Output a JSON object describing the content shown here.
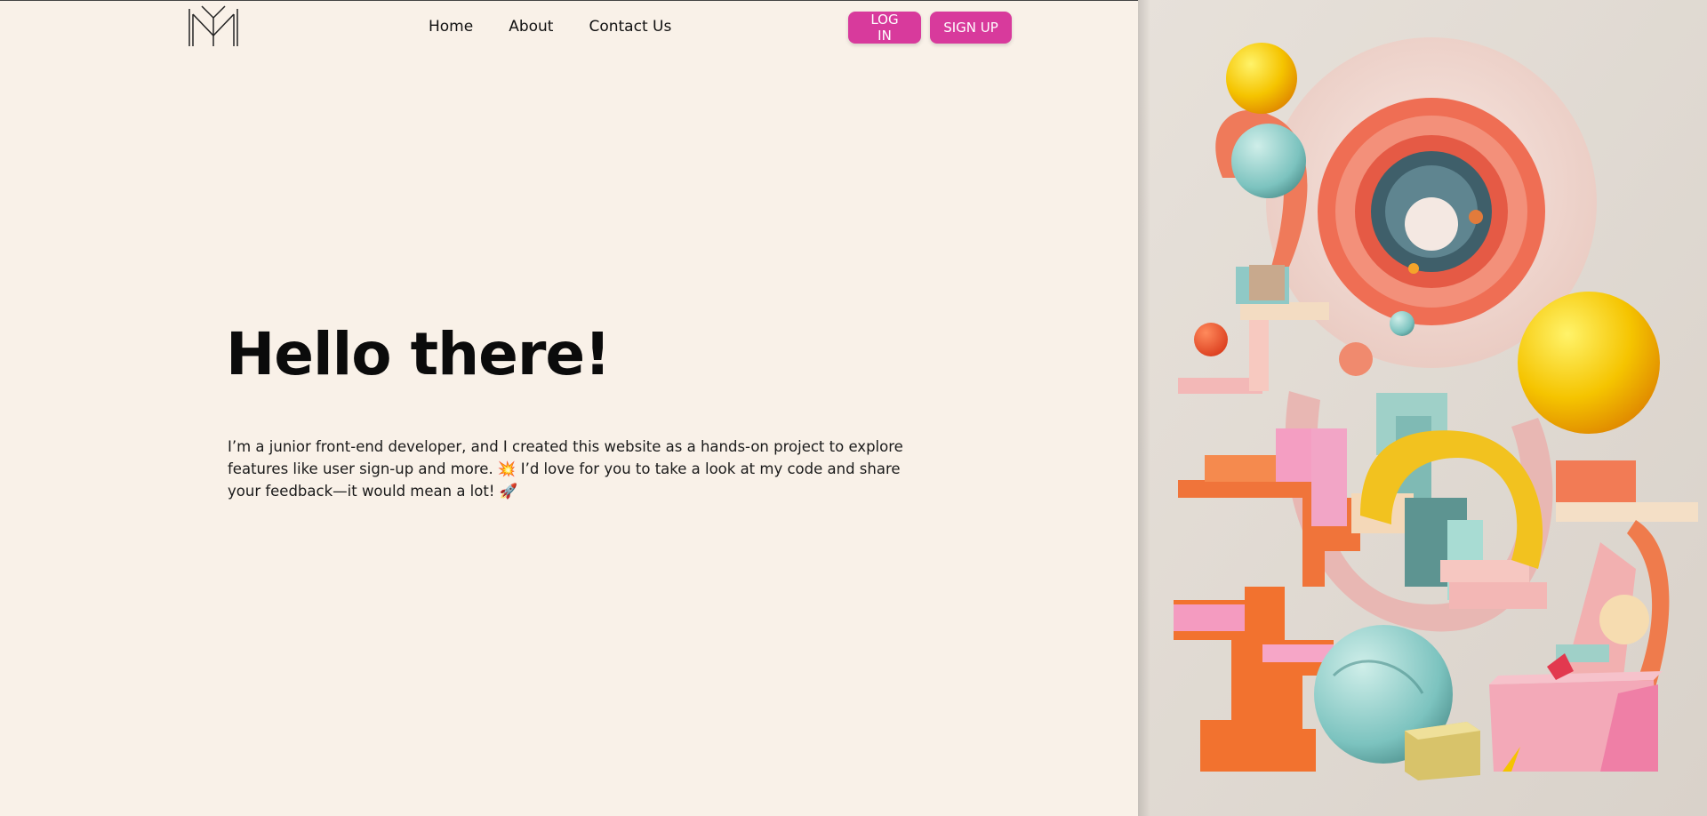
{
  "header": {
    "logo_icon": "monogram-m-logo",
    "nav": [
      {
        "label": "Home"
      },
      {
        "label": "About"
      },
      {
        "label": "Contact Us"
      }
    ],
    "login_label": "LOG IN",
    "signup_label": "SIGN UP"
  },
  "hero": {
    "title": "Hello there!",
    "text": "I’m a junior front-end developer, and I created this website as a hands-on project to explore features like user sign-up and more. 💥 I’d love for you to take a look at my code and share your feedback—it would mean a lot! 🚀"
  },
  "colors": {
    "background": "#f9f1e8",
    "accent": "#d83a9c"
  }
}
